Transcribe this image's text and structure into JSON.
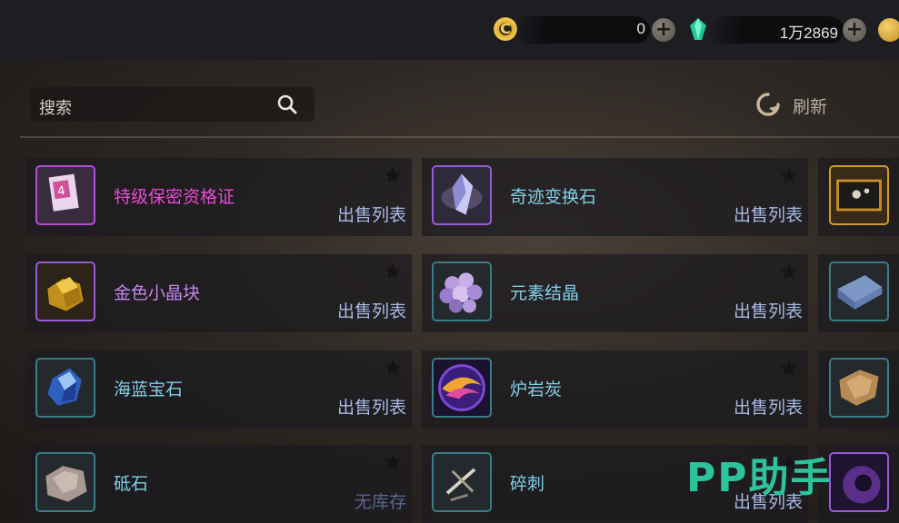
{
  "currency": {
    "coin_icon_glyph": "C",
    "coin_value": "0",
    "gem_value": "1万2869"
  },
  "search": {
    "placeholder": "搜索"
  },
  "refresh": {
    "label": "刷新"
  },
  "items": [
    {
      "name": "特级保密资格证",
      "status": "出售列表",
      "name_color": "#e64bd6",
      "icon": "certificate-icon",
      "border": "#b44dd6"
    },
    {
      "name": "奇迹变换石",
      "status": "出售列表",
      "name_color": "#7fd0e8",
      "icon": "crystal-icon",
      "border": "#9a5ad8"
    },
    {
      "name": "金色小晶块",
      "status": "出售列表",
      "name_color": "#c386ec",
      "icon": "gold-crystal-icon",
      "border": "#9a5ad8"
    },
    {
      "name": "元素结晶",
      "status": "出售列表",
      "name_color": "#7fd0e8",
      "icon": "element-crystal-icon",
      "border": "#3a7d86"
    },
    {
      "name": "海蓝宝石",
      "status": "出售列表",
      "name_color": "#7fd0e8",
      "icon": "aquamarine-icon",
      "border": "#3a7d86"
    },
    {
      "name": "炉岩炭",
      "status": "出售列表",
      "name_color": "#7fd0e8",
      "icon": "lava-coal-icon",
      "border": "#3a7d86"
    },
    {
      "name": "砥石",
      "status": "无库存",
      "name_color": "#7fd0e8",
      "icon": "whetstone-icon",
      "border": "#3a7d86"
    },
    {
      "name": "碎刺",
      "status": "出售列表",
      "name_color": "#7fd0e8",
      "icon": "shards-icon",
      "border": "#3a7d86"
    }
  ],
  "watermark": "PP助手"
}
